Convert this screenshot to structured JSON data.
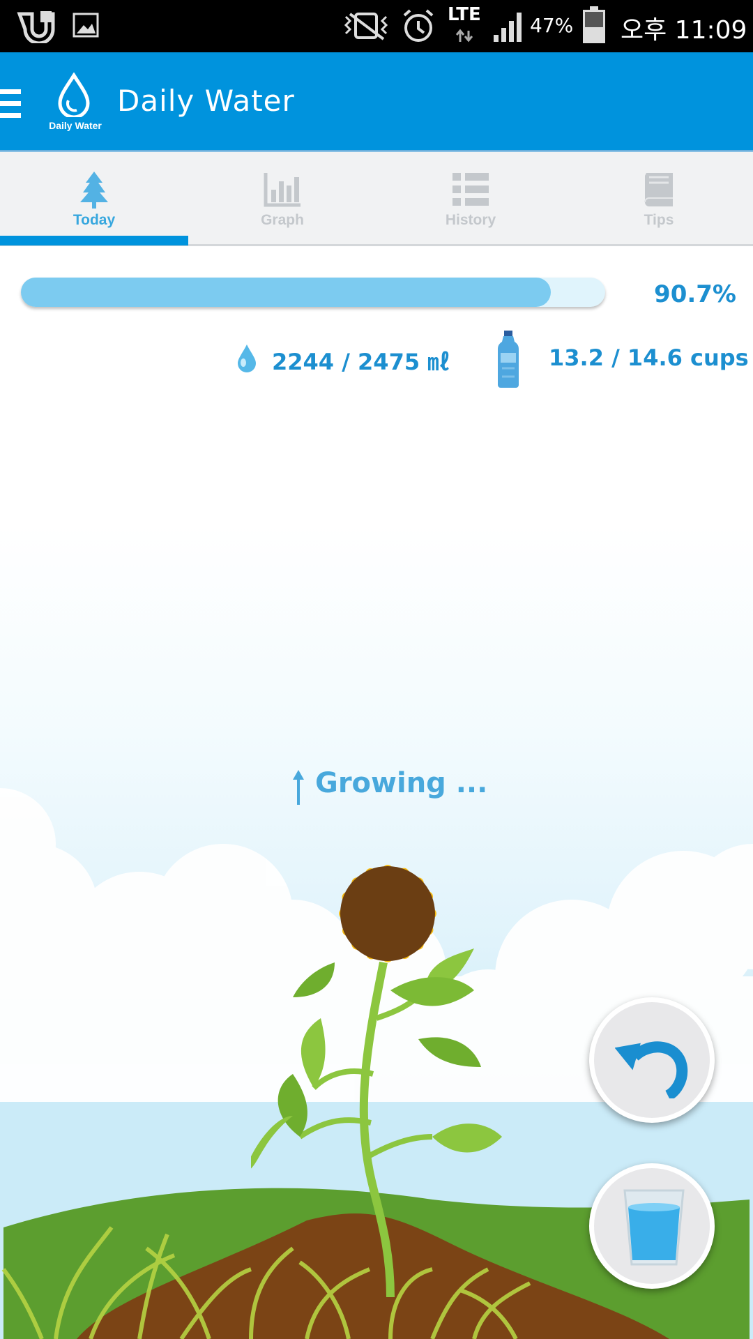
{
  "status_bar": {
    "battery": "47%",
    "network": "LTE",
    "time": "오후 11:09",
    "icons": [
      "app-notification-icon",
      "image-notification-icon",
      "vibrate-off-icon",
      "alarm-icon",
      "lte-icon",
      "signal-icon",
      "battery-icon"
    ]
  },
  "app_bar": {
    "title": "Daily Water",
    "logo_caption": "Daily Water",
    "icons": [
      "menu-icon",
      "water-drop-logo-icon"
    ]
  },
  "tabs": [
    {
      "label": "Today",
      "icon": "tree-icon",
      "active": true
    },
    {
      "label": "Graph",
      "icon": "bar-chart-icon",
      "active": false
    },
    {
      "label": "History",
      "icon": "list-icon",
      "active": false
    },
    {
      "label": "Tips",
      "icon": "book-icon",
      "active": false
    }
  ],
  "progress": {
    "fraction": 0.907,
    "percent_text": "90.7%"
  },
  "intake": {
    "ml_text": "2244 / 2475 ㎖",
    "cups_text": "13.2 / 14.6 cups",
    "icons": [
      "water-drop-icon",
      "water-bottle-icon"
    ]
  },
  "plant": {
    "status_text": "Growing ...",
    "icons": [
      "arrow-up-icon",
      "sunflower-illustration"
    ]
  },
  "actions": {
    "icons": [
      "undo-icon",
      "water-glass-icon"
    ]
  },
  "colors": {
    "primary": "#0093dd",
    "progress_fill": "#7ccbf0",
    "progress_track": "#e0f4fc",
    "text_accent": "#1c8fd0",
    "tab_inactive": "#c4c8cc"
  }
}
